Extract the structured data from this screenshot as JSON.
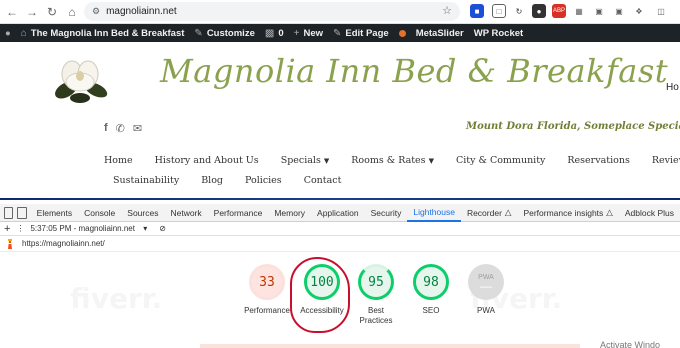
{
  "browser": {
    "url": "magnoliainn.net",
    "extensions": [
      {
        "name": "ext-blue",
        "color": "#1a4fd6"
      },
      {
        "name": "ext-gray",
        "color": "#5f6368"
      },
      {
        "name": "ext-dark",
        "color": "#333333"
      },
      {
        "name": "ext-red",
        "color": "#d93025"
      },
      {
        "name": "ext-gray2",
        "color": "#5f6368"
      }
    ]
  },
  "adminbar": {
    "site_name": "The Magnolia Inn Bed & Breakfast",
    "customize": "Customize",
    "comments_count": "0",
    "new": "New",
    "edit_page": "Edit Page",
    "metaslider": "MetaSlider",
    "wp_rocket": "WP Rocket"
  },
  "site": {
    "title": "Magnolia Inn Bed & Breakfast",
    "tagline": "Mount Dora Florida, Someplace Special",
    "ho": "Ho",
    "nav_row1": [
      "Home",
      "History and About Us",
      "Specials",
      "Rooms & Rates",
      "City & Community",
      "Reservations",
      "Reviews"
    ],
    "nav_row2": [
      "Sustainability",
      "Blog",
      "Policies",
      "Contact"
    ]
  },
  "devtools": {
    "tabs": [
      "Elements",
      "Console",
      "Sources",
      "Network",
      "Performance",
      "Memory",
      "Application",
      "Security",
      "Lighthouse",
      "Recorder",
      "Performance insights",
      "Adblock Plus"
    ],
    "active_tab": "Lighthouse",
    "report_time": "5:37:05 PM - magnoliainn.net",
    "tested_url": "https://magnoliainn.net/"
  },
  "scores": [
    {
      "label": "Performance",
      "value": "33",
      "color": "#c33300",
      "bg": "#fde4e1"
    },
    {
      "label": "Accessibility",
      "value": "100",
      "color": "#018642",
      "bg": "#e6f6ed"
    },
    {
      "label": "Best Practices",
      "value": "95",
      "color": "#018642",
      "bg": "#e6f6ed"
    },
    {
      "label": "SEO",
      "value": "98",
      "color": "#018642",
      "bg": "#e6f6ed"
    },
    {
      "label": "PWA",
      "value": "—",
      "color": "#9e9e9e",
      "bg": "#e0e0e0"
    }
  ],
  "pwa_badge": "PWA",
  "watermark_text": "fiverr.",
  "activate_text": "Activate Windo"
}
